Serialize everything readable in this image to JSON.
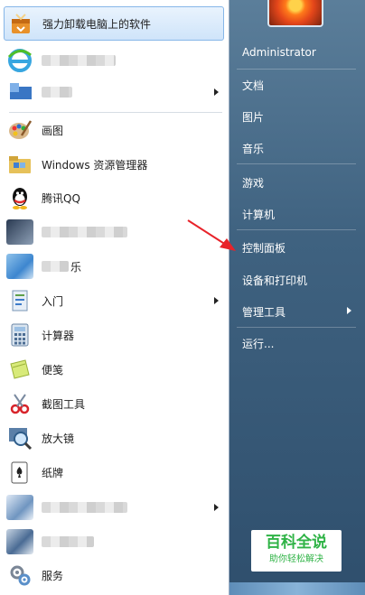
{
  "left_panel": {
    "pinned_top": "强力卸载电脑上的软件",
    "items": [
      {
        "label": "画图",
        "icon": "paint-icon"
      },
      {
        "label": "Windows 资源管理器",
        "icon": "explorer-icon"
      },
      {
        "label": "腾讯QQ",
        "icon": "qq-icon"
      },
      {
        "label": "乐",
        "icon": "blurred-icon"
      },
      {
        "label": "入门",
        "icon": "getting-started-icon"
      },
      {
        "label": "计算器",
        "icon": "calculator-icon"
      },
      {
        "label": "便笺",
        "icon": "sticky-notes-icon"
      },
      {
        "label": "截图工具",
        "icon": "snipping-tool-icon"
      },
      {
        "label": "放大镜",
        "icon": "magnifier-icon"
      },
      {
        "label": "纸牌",
        "icon": "solitaire-icon"
      },
      {
        "label": "服务",
        "icon": "services-icon"
      }
    ]
  },
  "right_panel": {
    "user": "Administrator",
    "items": [
      "文档",
      "图片",
      "音乐",
      "游戏",
      "计算机",
      "控制面板",
      "设备和打印机",
      "管理工具",
      "运行..."
    ]
  },
  "watermark": {
    "title": "百科全说",
    "subtitle": "助你轻松解决"
  },
  "colors": {
    "accent_green": "#2fb346",
    "pointer_red": "#e8232a"
  }
}
